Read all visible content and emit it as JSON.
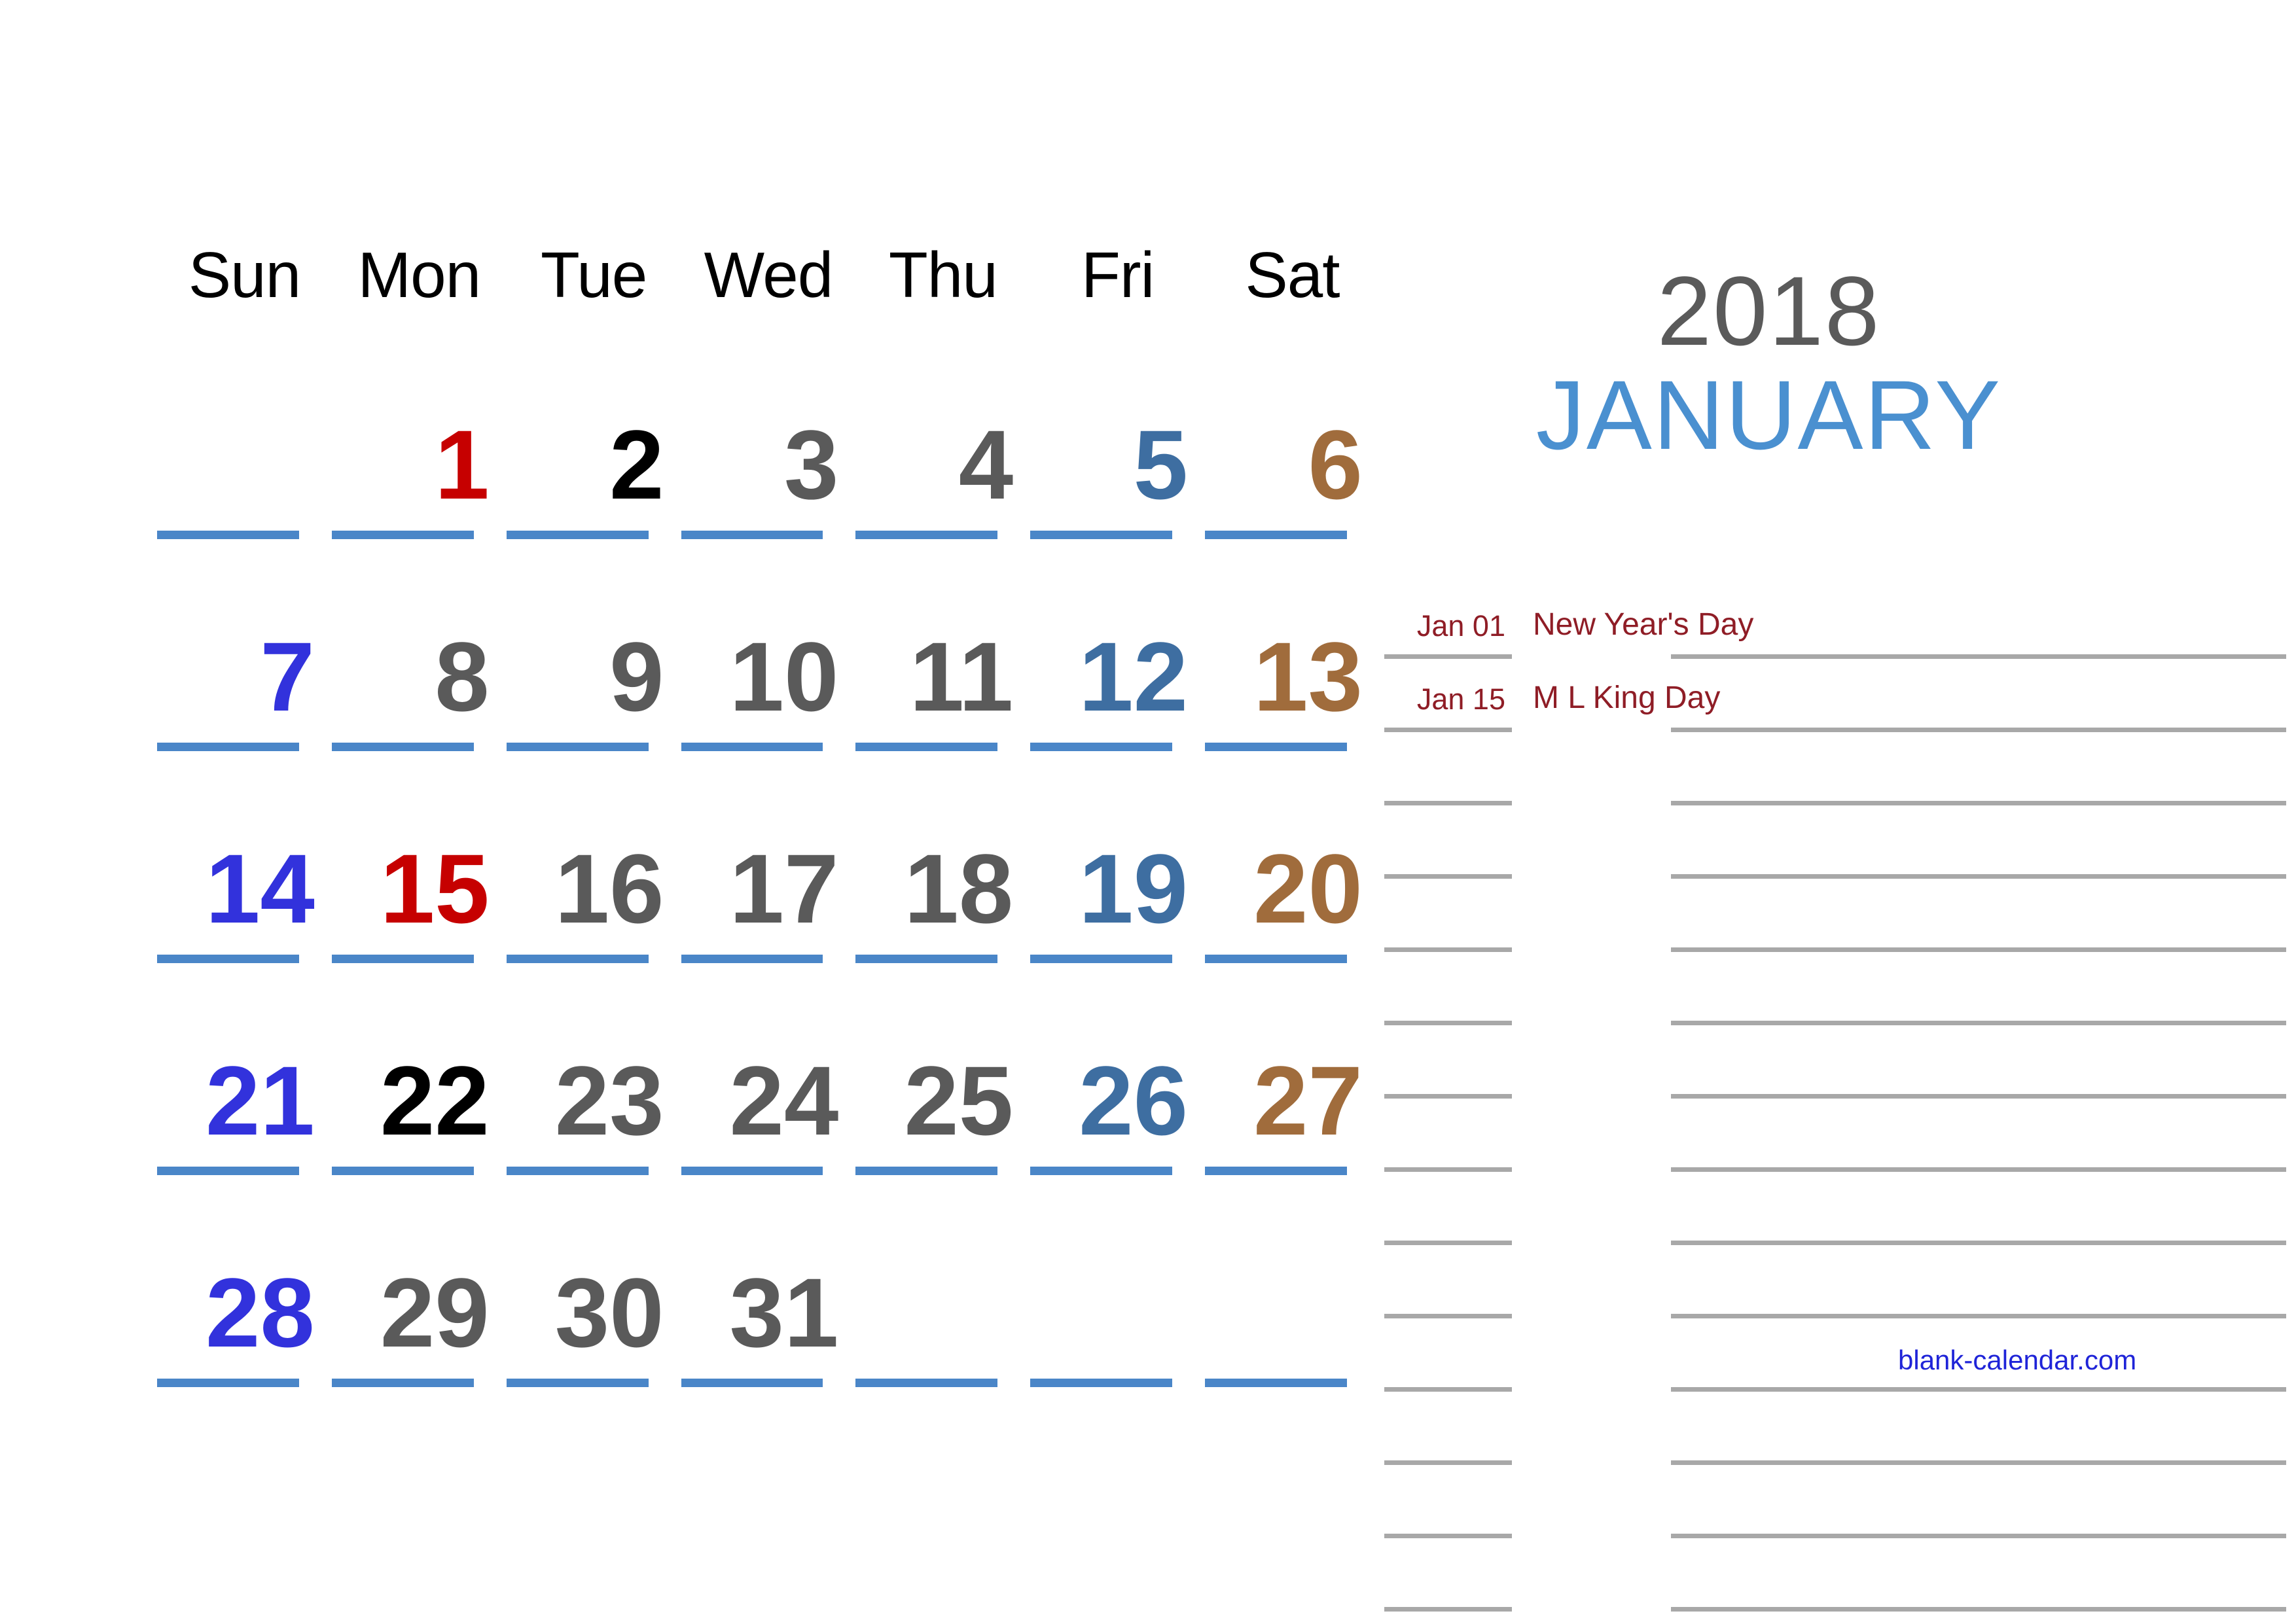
{
  "calendar": {
    "year": "2018",
    "month": "JANUARY",
    "weekday_headers": [
      "Sun",
      "Mon",
      "Tue",
      "Wed",
      "Thu",
      "Fri",
      "Sat"
    ],
    "weeks": [
      [
        {
          "day": "",
          "color_class": "c-empty"
        },
        {
          "day": "1",
          "color_class": "c-holiday"
        },
        {
          "day": "2",
          "color_class": "c-black"
        },
        {
          "day": "3",
          "color_class": "c-weekday"
        },
        {
          "day": "4",
          "color_class": "c-weekday"
        },
        {
          "day": "5",
          "color_class": "c-fri"
        },
        {
          "day": "6",
          "color_class": "c-sat"
        }
      ],
      [
        {
          "day": "7",
          "color_class": "c-sun"
        },
        {
          "day": "8",
          "color_class": "c-weekday"
        },
        {
          "day": "9",
          "color_class": "c-weekday"
        },
        {
          "day": "10",
          "color_class": "c-weekday"
        },
        {
          "day": "11",
          "color_class": "c-weekday"
        },
        {
          "day": "12",
          "color_class": "c-fri"
        },
        {
          "day": "13",
          "color_class": "c-sat"
        }
      ],
      [
        {
          "day": "14",
          "color_class": "c-sun"
        },
        {
          "day": "15",
          "color_class": "c-holiday"
        },
        {
          "day": "16",
          "color_class": "c-weekday"
        },
        {
          "day": "17",
          "color_class": "c-weekday"
        },
        {
          "day": "18",
          "color_class": "c-weekday"
        },
        {
          "day": "19",
          "color_class": "c-fri"
        },
        {
          "day": "20",
          "color_class": "c-sat"
        }
      ],
      [
        {
          "day": "21",
          "color_class": "c-sun"
        },
        {
          "day": "22",
          "color_class": "c-black"
        },
        {
          "day": "23",
          "color_class": "c-weekday"
        },
        {
          "day": "24",
          "color_class": "c-weekday"
        },
        {
          "day": "25",
          "color_class": "c-weekday"
        },
        {
          "day": "26",
          "color_class": "c-fri"
        },
        {
          "day": "27",
          "color_class": "c-sat"
        }
      ],
      [
        {
          "day": "28",
          "color_class": "c-sun"
        },
        {
          "day": "29",
          "color_class": "c-weekday"
        },
        {
          "day": "30",
          "color_class": "c-weekday"
        },
        {
          "day": "31",
          "color_class": "c-weekday"
        },
        {
          "day": "",
          "color_class": "c-empty"
        },
        {
          "day": "",
          "color_class": "c-empty"
        },
        {
          "day": "",
          "color_class": "c-empty"
        }
      ]
    ]
  },
  "notes": {
    "rows": [
      {
        "date": "Jan 01",
        "event": "New Year's Day"
      },
      {
        "date": "Jan 15",
        "event": "M L King Day"
      },
      {
        "date": "",
        "event": ""
      },
      {
        "date": "",
        "event": ""
      },
      {
        "date": "",
        "event": ""
      },
      {
        "date": "",
        "event": ""
      },
      {
        "date": "",
        "event": ""
      },
      {
        "date": "",
        "event": ""
      },
      {
        "date": "",
        "event": ""
      },
      {
        "date": "",
        "event": ""
      },
      {
        "date": "",
        "event": ""
      },
      {
        "date": "",
        "event": ""
      },
      {
        "date": "",
        "event": ""
      },
      {
        "date": "",
        "event": ""
      }
    ]
  },
  "footer": {
    "watermark": "blank-calendar.com"
  },
  "colors": {
    "sunday": "#3232dc",
    "weekday": "#5a5a5a",
    "friday": "#3e6ea1",
    "saturday": "#a06c3c",
    "holiday": "#c60000",
    "bold_day": "#000000",
    "day_rule": "#4a86c8",
    "month_title": "#4a90d0",
    "year_title": "#5a5a5a",
    "note_text": "#8f1d26",
    "note_rule": "#a8a8a8",
    "watermark": "#1f24d8",
    "background": "#ffffff"
  }
}
